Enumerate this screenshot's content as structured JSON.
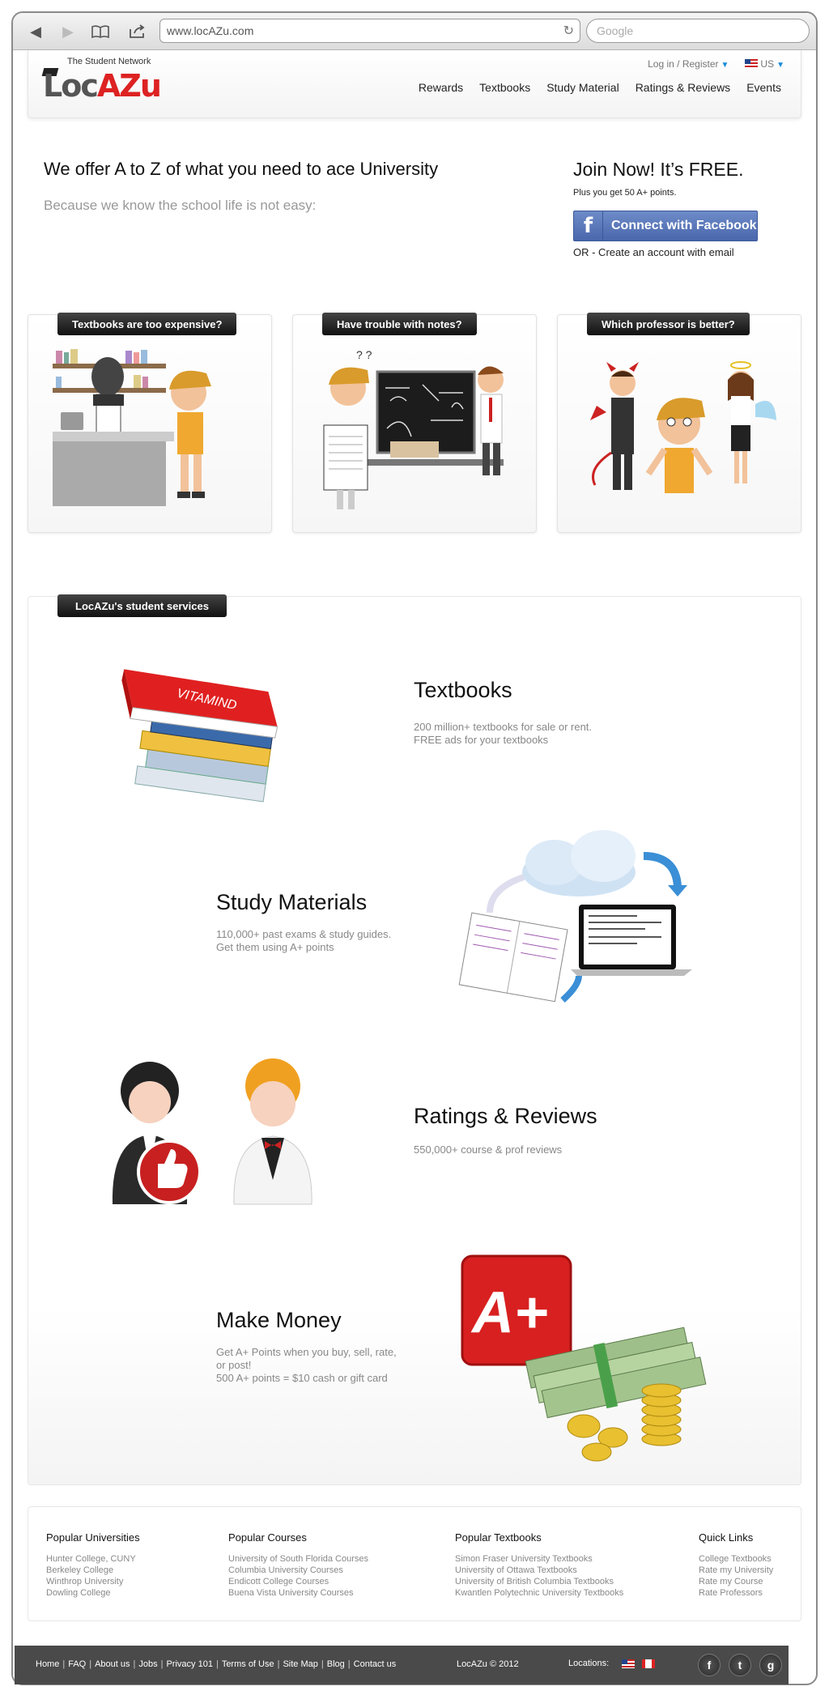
{
  "browser": {
    "url": "www.locAZu.com",
    "search_placeholder": "Google"
  },
  "header": {
    "logo_tagline": "The Student Network",
    "logo_part1": "Loc",
    "logo_part2": "AZu",
    "login": "Log in / Register",
    "locale": "US",
    "nav": [
      "Rewards",
      "Textbooks",
      "Study Material",
      "Ratings & Reviews",
      "Events"
    ]
  },
  "hero": {
    "title": "We offer A to Z of what you need to ace University",
    "subtitle": "Because we know the school life is not easy:",
    "join_title": "Join Now! It’s FREE.",
    "join_points": "Plus you get 50 A+ points.",
    "fb_button": "Connect with Facebook",
    "email_option": "OR - Create an account with email"
  },
  "cards": [
    {
      "label": "Textbooks are too expensive?"
    },
    {
      "label": "Have trouble with notes?"
    },
    {
      "label": "Which professor is better?"
    }
  ],
  "services": {
    "heading": "LocAZu's student services",
    "book_spine": "VITAMIND",
    "aplus": "A+",
    "items": [
      {
        "title": "Textbooks",
        "lines": [
          "200 million+ textbooks for sale or rent.",
          "FREE ads for your textbooks"
        ]
      },
      {
        "title": "Study Materials",
        "lines": [
          "110,000+ past exams & study guides.",
          "Get them using A+ points"
        ]
      },
      {
        "title": "Ratings & Reviews",
        "lines": [
          "550,000+ course & prof reviews"
        ]
      },
      {
        "title": "Make Money",
        "lines": [
          "Get A+ Points when you buy, sell, rate,",
          "or post!",
          "500 A+ points = $10 cash or gift card"
        ]
      }
    ]
  },
  "footer": {
    "columns": [
      {
        "title": "Popular Universities",
        "items": [
          "Hunter College, CUNY",
          "Berkeley College",
          "Winthrop University",
          "Dowling College"
        ]
      },
      {
        "title": "Popular Courses",
        "items": [
          "University of South Florida Courses",
          "Columbia University Courses",
          "Endicott College Courses",
          "Buena Vista University Courses"
        ]
      },
      {
        "title": "Popular Textbooks",
        "items": [
          "Simon Fraser University Textbooks",
          "University of Ottawa Textbooks",
          "University of British Columbia Textbooks",
          "Kwantlen Polytechnic University Textbooks"
        ]
      },
      {
        "title": "Quick Links",
        "items": [
          "College Textbooks",
          "Rate my University",
          "Rate my Course",
          "Rate Professors"
        ]
      }
    ],
    "bottom_links": [
      "Home",
      "FAQ",
      "About us",
      "Jobs",
      "Privacy 101",
      "Terms of Use",
      "Site Map",
      "Blog",
      "Contact us"
    ],
    "copyright": "LocAZu © 2012",
    "locations_label": "Locations:",
    "social": [
      "f",
      "t",
      "g"
    ]
  },
  "colors": {
    "brand_red": "#dd2222",
    "facebook_blue": "#4a67ac",
    "link_blue": "#1a8bd6"
  }
}
